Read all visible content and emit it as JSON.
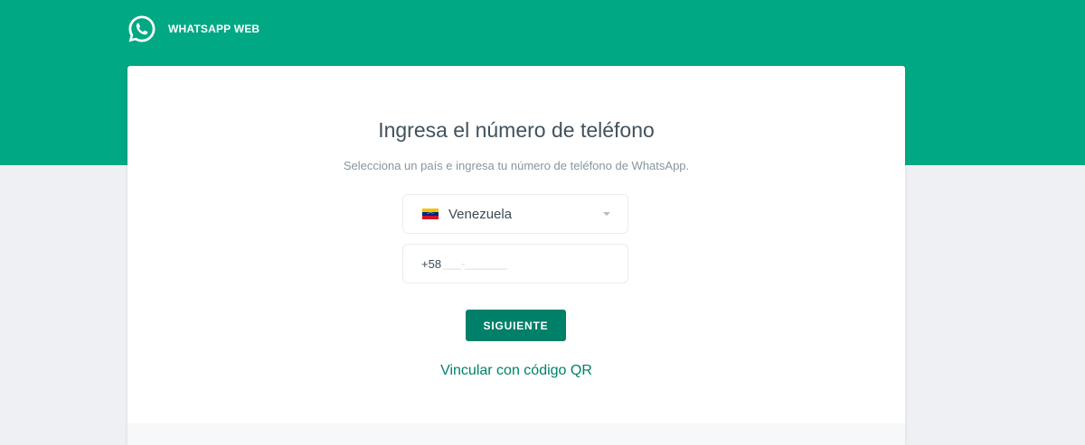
{
  "header": {
    "brand": "WHATSAPP WEB",
    "logo_icon": "whatsapp-logo-icon"
  },
  "colors": {
    "brand_green": "#00a884",
    "button_green": "#008069",
    "link_green": "#00806a",
    "page_background": "#eff0f3"
  },
  "card": {
    "title": "Ingresa el número de teléfono",
    "subtitle": "Selecciona un país e ingresa tu número de teléfono de WhatsApp.",
    "country_select": {
      "flag_icon": "venezuela-flag-icon",
      "value": "Venezuela",
      "chevron_icon": "chevron-down-icon"
    },
    "phone": {
      "prefix": "+58",
      "value": "",
      "placeholder": "___-_______"
    },
    "next_button": "SIGUIENTE",
    "qr_link": "Vincular con código QR"
  }
}
